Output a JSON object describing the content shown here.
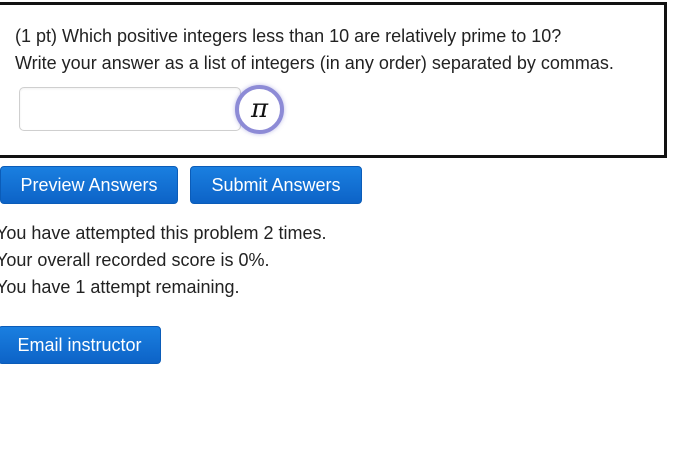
{
  "problem": {
    "line1": "(1 pt) Which positive integers less than 10 are relatively prime to 10?",
    "line2": "Write your answer as a list of integers (in any order) separated by commas.",
    "answer_value": "",
    "pi_symbol": "π"
  },
  "buttons": {
    "preview_label": "Preview Answers",
    "submit_label": "Submit Answers",
    "email_label": "Email instructor"
  },
  "status": {
    "attempts": "You have attempted this problem 2 times.",
    "score": "Your overall recorded score is 0%.",
    "remaining": "You have 1 attempt remaining."
  },
  "colors": {
    "button_blue": "#1a7fe0",
    "pi_ring": "#8d8bd6",
    "box_border": "#111111"
  },
  "icons": {
    "equation_editor": "pi-icon"
  }
}
